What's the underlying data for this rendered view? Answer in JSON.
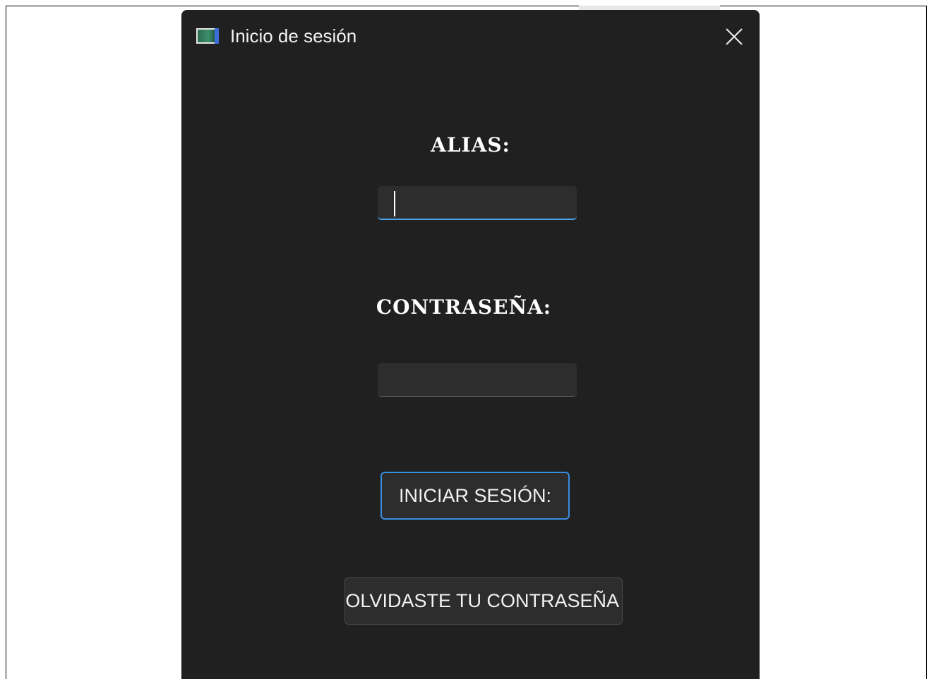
{
  "window": {
    "title": "Inicio de sesión"
  },
  "form": {
    "alias_label": "ALIAS:",
    "alias_value": "",
    "password_label": "CONTRASEÑA:",
    "password_value": "",
    "login_button": "INICIAR SESIÓN:",
    "forgot_button": "OLVIDASTE TU CONTRASEÑA"
  },
  "icons": {
    "app": "app-window-icon",
    "close": "close-icon"
  },
  "colors": {
    "window_bg": "#202020",
    "input_bg": "#2d2d2d",
    "accent": "#3a8ee0",
    "text": "#ffffff"
  }
}
